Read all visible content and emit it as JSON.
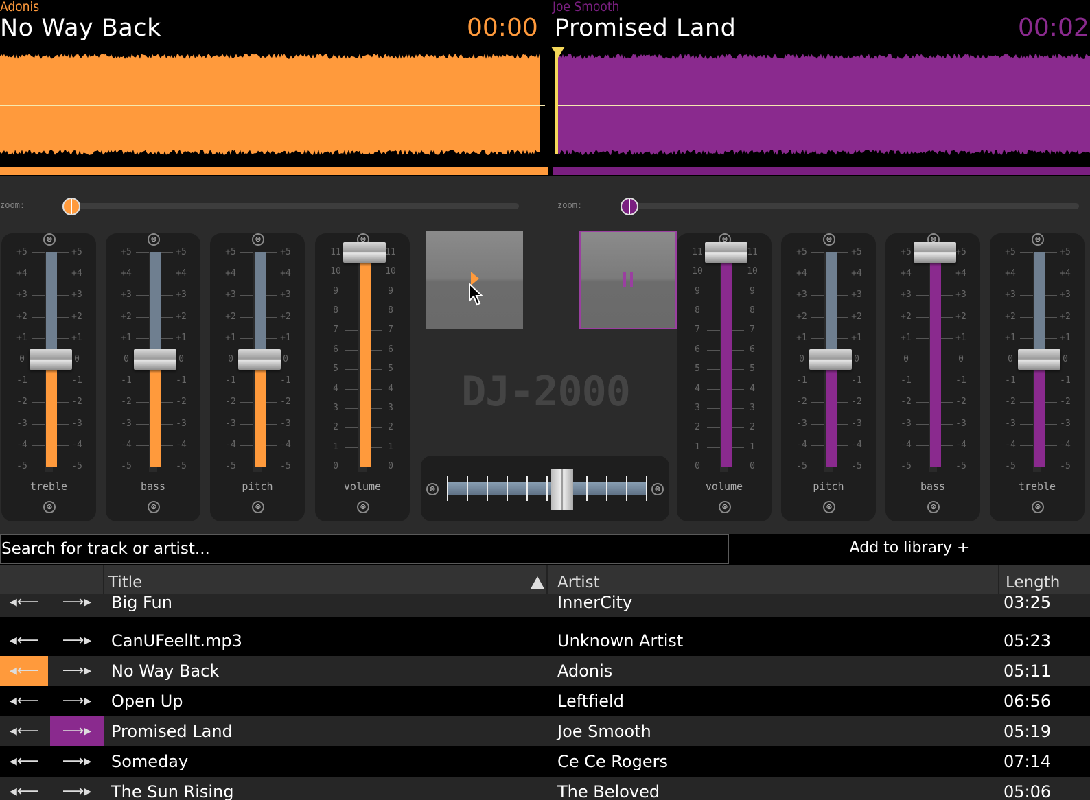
{
  "deckA": {
    "artist": "Adonis",
    "title": "No Way Back",
    "time": "00:00",
    "color": "#ff9a3c"
  },
  "deckB": {
    "artist": "Joe Smooth",
    "title": "Promised Land",
    "time": "00:02",
    "color": "#8a2a8e"
  },
  "zoom_label": "zoom:",
  "mixer": {
    "left_panels": [
      {
        "label": "treble",
        "scale": [
          "+5",
          "+4",
          "+3",
          "+2",
          "+1",
          "0",
          "-1",
          "-2",
          "-3",
          "-4",
          "-5"
        ],
        "value": 0
      },
      {
        "label": "bass",
        "scale": [
          "+5",
          "+4",
          "+3",
          "+2",
          "+1",
          "0",
          "-1",
          "-2",
          "-3",
          "-4",
          "-5"
        ],
        "value": 0
      },
      {
        "label": "pitch",
        "scale": [
          "+5",
          "+4",
          "+3",
          "+2",
          "+1",
          "0",
          "-1",
          "-2",
          "-3",
          "-4",
          "-5"
        ],
        "value": 0
      },
      {
        "label": "volume",
        "scale": [
          "11",
          "10",
          "9",
          "8",
          "7",
          "6",
          "5",
          "4",
          "3",
          "2",
          "1",
          "0"
        ],
        "value": 11
      }
    ],
    "right_panels": [
      {
        "label": "volume",
        "scale": [
          "11",
          "10",
          "9",
          "8",
          "7",
          "6",
          "5",
          "4",
          "3",
          "2",
          "1",
          "0"
        ],
        "value": 11
      },
      {
        "label": "pitch",
        "scale": [
          "+5",
          "+4",
          "+3",
          "+2",
          "+1",
          "0",
          "-1",
          "-2",
          "-3",
          "-4",
          "-5"
        ],
        "value": 0
      },
      {
        "label": "bass",
        "scale": [
          "+5",
          "+4",
          "+3",
          "+2",
          "+1",
          "0",
          "-1",
          "-2",
          "-3",
          "-4",
          "-5"
        ],
        "value": 5
      },
      {
        "label": "treble",
        "scale": [
          "+5",
          "+4",
          "+3",
          "+2",
          "+1",
          "0",
          "-1",
          "-2",
          "-3",
          "-4",
          "-5"
        ],
        "value": 0
      }
    ],
    "logo": "DJ-2000",
    "crossfader_value": 0.58,
    "reset_glyph": "⊗"
  },
  "search": {
    "placeholder": "Search for track or artist..."
  },
  "add_library": "Add to library +",
  "table": {
    "headers": {
      "title": "Title",
      "artist": "Artist",
      "length": "Length"
    },
    "rows": [
      {
        "title": "Big Fun",
        "artist": "InnerCity",
        "length": "03:25"
      },
      {
        "title": "CanUFeelIt.mp3",
        "artist": "Unknown Artist",
        "length": "05:23"
      },
      {
        "title": "No Way Back",
        "artist": "Adonis",
        "length": "05:11"
      },
      {
        "title": "Open Up",
        "artist": "Leftfield",
        "length": "06:56"
      },
      {
        "title": "Promised Land",
        "artist": "Joe Smooth",
        "length": "05:19"
      },
      {
        "title": "Someday",
        "artist": "Ce Ce Rogers",
        "length": "07:14"
      },
      {
        "title": "The Sun Rising",
        "artist": "The Beloved",
        "length": "05:06"
      }
    ],
    "cue_left_glyph": "◂",
    "cue_right_glyph": "▸"
  }
}
